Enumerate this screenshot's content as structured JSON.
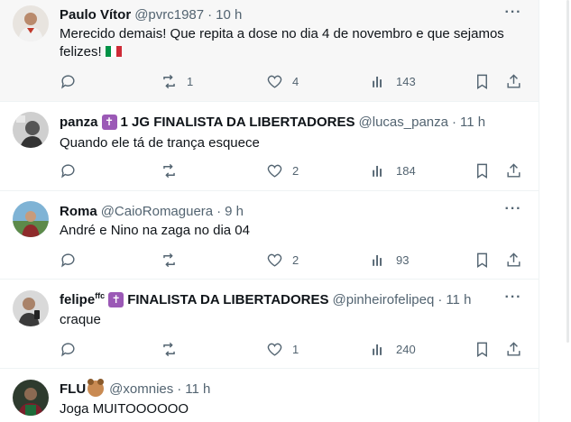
{
  "posts": [
    {
      "name": "Paulo Vítor",
      "handle": "@pvrc1987",
      "time": "10 h",
      "text_line1": "Merecido demais! Que repita a dose no dia 4 de novembro e que sejamos",
      "text_line2": "felizes!",
      "flag_icon": "italy-flag-icon",
      "replies": "",
      "reposts": "1",
      "likes": "4",
      "views": "143"
    },
    {
      "name": "panza",
      "badge_icon": "cross-icon",
      "name_suffix": "1 JG FINALISTA DA LIBERTADORES",
      "handle": "@lucas_panza",
      "time": "11 h",
      "text": "Quando ele tá de trança esquece",
      "replies": "",
      "reposts": "",
      "likes": "2",
      "views": "184"
    },
    {
      "name": "Roma",
      "handle": "@CaioRomaguera",
      "time": "9 h",
      "text": "André e Nino na zaga no dia 04",
      "replies": "",
      "reposts": "",
      "likes": "2",
      "views": "93"
    },
    {
      "name": "felipe",
      "name_sup": "ffc",
      "badge_icon": "cross-icon",
      "name_suffix": "FINALISTA DA LIBERTADORES",
      "handle": "@pinheirofelipeq",
      "time": "11 h",
      "text": "craque",
      "replies": "",
      "reposts": "",
      "likes": "1",
      "views": "240"
    },
    {
      "name": "FLU",
      "badge_icon": "bear-icon",
      "handle": "@xomnies",
      "time": "11 h",
      "text": "Joga MUITOOOOOO"
    }
  ],
  "colors": {
    "text_primary": "#0f1419",
    "text_secondary": "#536471",
    "border": "#eff3f4",
    "badge_purple": "#9b59b6",
    "highlight_bg": "#f7f7f7"
  },
  "sep": "·",
  "more_glyph": "···"
}
